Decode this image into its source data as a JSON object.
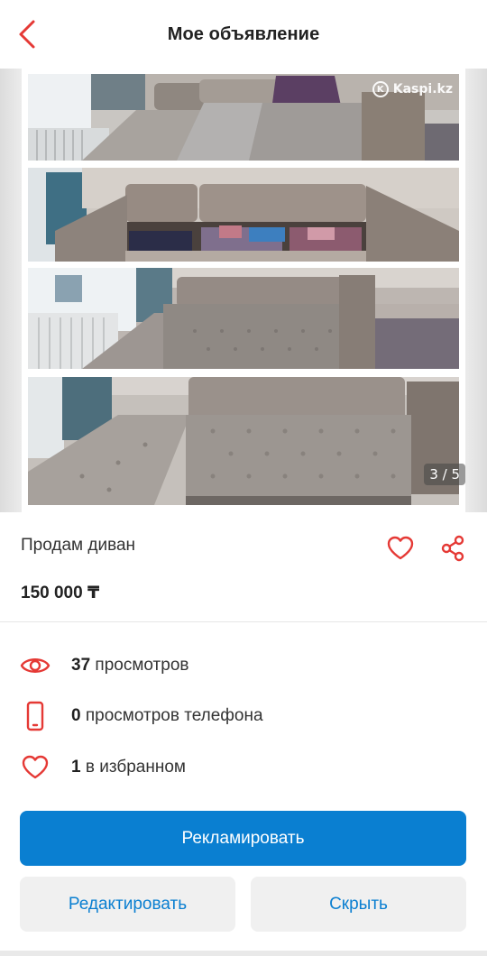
{
  "header": {
    "title": "Мое объявление",
    "back_icon": "chevron-left-icon"
  },
  "gallery": {
    "watermark": "Kaspi.kz",
    "counter": "3 / 5"
  },
  "ad": {
    "title": "Продам диван",
    "price": "150 000 ₸"
  },
  "stats": [
    {
      "icon": "eye-icon",
      "count": "37",
      "label": "просмотров"
    },
    {
      "icon": "phone-icon",
      "count": "0",
      "label": "просмотров телефона"
    },
    {
      "icon": "heart-icon",
      "count": "1",
      "label": "в избранном"
    }
  ],
  "actions": {
    "promote": "Рекламировать",
    "edit": "Редактировать",
    "hide": "Скрыть"
  },
  "colors": {
    "accent_red": "#e53935",
    "primary_blue": "#0a7fd1",
    "secondary_bg": "#f0f0f0"
  }
}
